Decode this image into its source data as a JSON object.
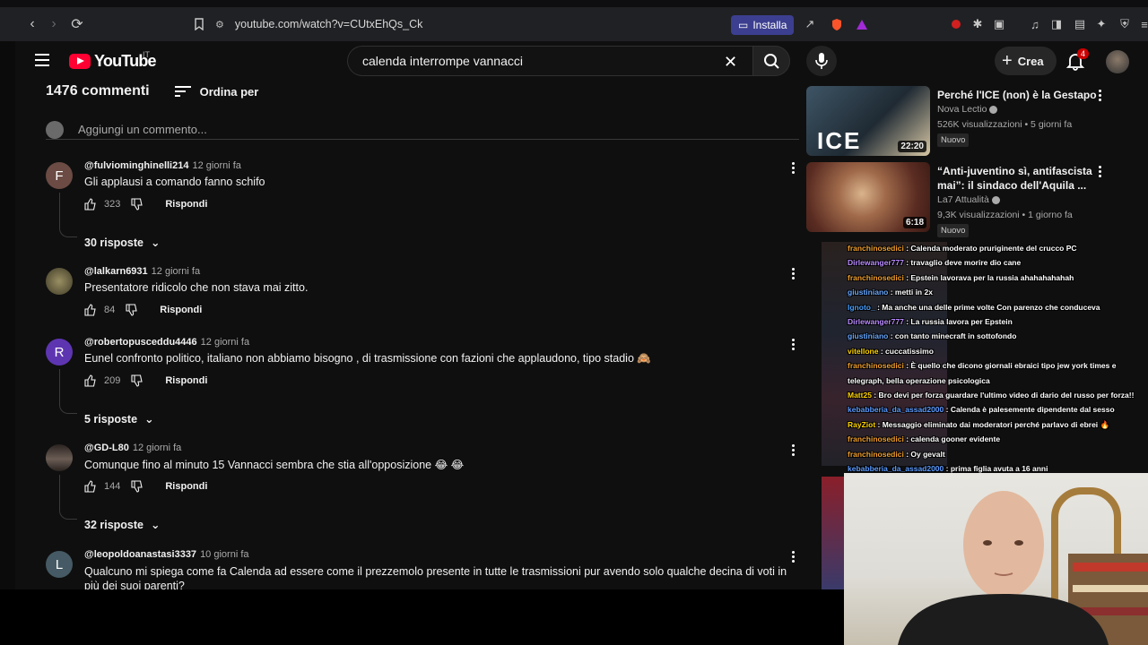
{
  "browser": {
    "url": "youtube.com/watch?v=CUtxEhQs_Ck",
    "install_label": "Installa"
  },
  "header": {
    "logo_text": "YouTube",
    "region": "IT",
    "search_value": "calenda interrompe vannacci",
    "create_label": "Crea",
    "notification_count": "4"
  },
  "comments": {
    "count_label": "1476 commenti",
    "sort_label": "Ordina per",
    "add_placeholder": "Aggiungi un commento...",
    "reply_label": "Rispondi",
    "items": [
      {
        "user": "@fulviominghinelli214",
        "time": "12 giorni fa",
        "text": "Gli applausi a comando fanno schifo",
        "likes": "323",
        "avatar_letter": "F",
        "replies": "30 risposte"
      },
      {
        "user": "@lalkarn6931",
        "time": "12 giorni fa",
        "text": "Presentatore ridicolo che non stava mai zitto.",
        "likes": "84",
        "avatar_letter": "",
        "replies": ""
      },
      {
        "user": "@robertopusceddu4446",
        "time": "12 giorni fa",
        "text": "Eunel confronto politico, italiano non abbiamo bisogno , di trasmissione   con fazioni che applaudono, tipo stadio 🙈",
        "likes": "209",
        "avatar_letter": "R",
        "replies": "5 risposte"
      },
      {
        "user": "@GD-L80",
        "time": "12 giorni fa",
        "text": "Comunque fino al minuto 15 Vannacci sembra che stia all'opposizione 😂 😂",
        "likes": "144",
        "avatar_letter": "",
        "replies": "32 risposte"
      },
      {
        "user": "@leopoldoanastasi3337",
        "time": "10 giorni fa",
        "text": "Qualcuno mi spiega come fa Calenda ad essere come il prezzemolo presente in tutte le trasmissioni pur avendo solo qualche decina di voti in più dei suoi parenti?",
        "likes": "",
        "avatar_letter": "L",
        "replies": ""
      }
    ]
  },
  "sidebar": {
    "items": [
      {
        "title": "Perché l'ICE (non) è la Gestapo",
        "channel": "Nova Lectio",
        "stats": "526K visualizzazioni • 5 giorni fa",
        "duration": "22:20",
        "badge": "Nuovo",
        "thumb_text": "ICE"
      },
      {
        "title": "“Anti-juventino sì, antifascista mai”: il sindaco dell'Aquila ...",
        "channel": "La7 Attualità",
        "stats": "9,3K visualizzazioni • 1 giorno fa",
        "duration": "6:18",
        "badge": "Nuovo",
        "thumb_text": ""
      }
    ]
  },
  "chat": {
    "lines": [
      {
        "user": "franchinosedici",
        "msg": ": Calenda moderato pruriginente del crucco PC",
        "color": "#f0a030"
      },
      {
        "user": "Dirlewanger777",
        "msg": ": travaglio deve morire dio cane",
        "color": "#b98cff"
      },
      {
        "user": "franchinosedici",
        "msg": ": Epstein lavorava per la russia ahahahahahah",
        "color": "#f0a030"
      },
      {
        "user": "giustiniano",
        "msg": ": metti in 2x",
        "color": "#6aa8ff"
      },
      {
        "user": "Ignoto_",
        "msg": ": Ma anche una delle prime volte Con parenzo che conduceva",
        "color": "#4aa0ff"
      },
      {
        "user": "Dirlewanger777",
        "msg": ": La russia lavora per Epstein",
        "color": "#b98cff"
      },
      {
        "user": "giustiniano",
        "msg": ": con tanto minecraft in sottofondo",
        "color": "#6aa8ff"
      },
      {
        "user": "vitellone",
        "msg": ": cuccatissimo",
        "color": "#ffd400"
      },
      {
        "user": "franchinosedici",
        "msg": ": È quello che dicono giornali ebraici tipo jew york times e",
        "color": "#f0a030"
      },
      {
        "user": "",
        "msg": "telegraph, bella operazione psicologica",
        "color": "#f0a030"
      },
      {
        "user": "Matt25",
        "msg": ": Bro devi per forza guardare l'ultimo video di dario del russo per forza!!",
        "color": "#ffd400"
      },
      {
        "user": "kebabberia_da_assad2000",
        "msg": ": Calenda è palesemente dipendente dal sesso",
        "color": "#5b9bff"
      },
      {
        "user": "RayZiot",
        "msg": ": Messaggio eliminato dai moderatori perché parlavo di ebrei 🔥",
        "color": "#ffd400"
      },
      {
        "user": "franchinosedici",
        "msg": ": calenda gooner evidente",
        "color": "#f0a030"
      },
      {
        "user": "franchinosedici",
        "msg": ": Oy gevalt",
        "color": "#f0a030"
      },
      {
        "user": "kebabberia_da_assad2000",
        "msg": ": prima figlia avuta a 16 anni",
        "color": "#5b9bff"
      }
    ]
  },
  "colors": {
    "yt_red": "#ff0033",
    "background": "#0f0f0f",
    "install": "#3c3f8f"
  }
}
